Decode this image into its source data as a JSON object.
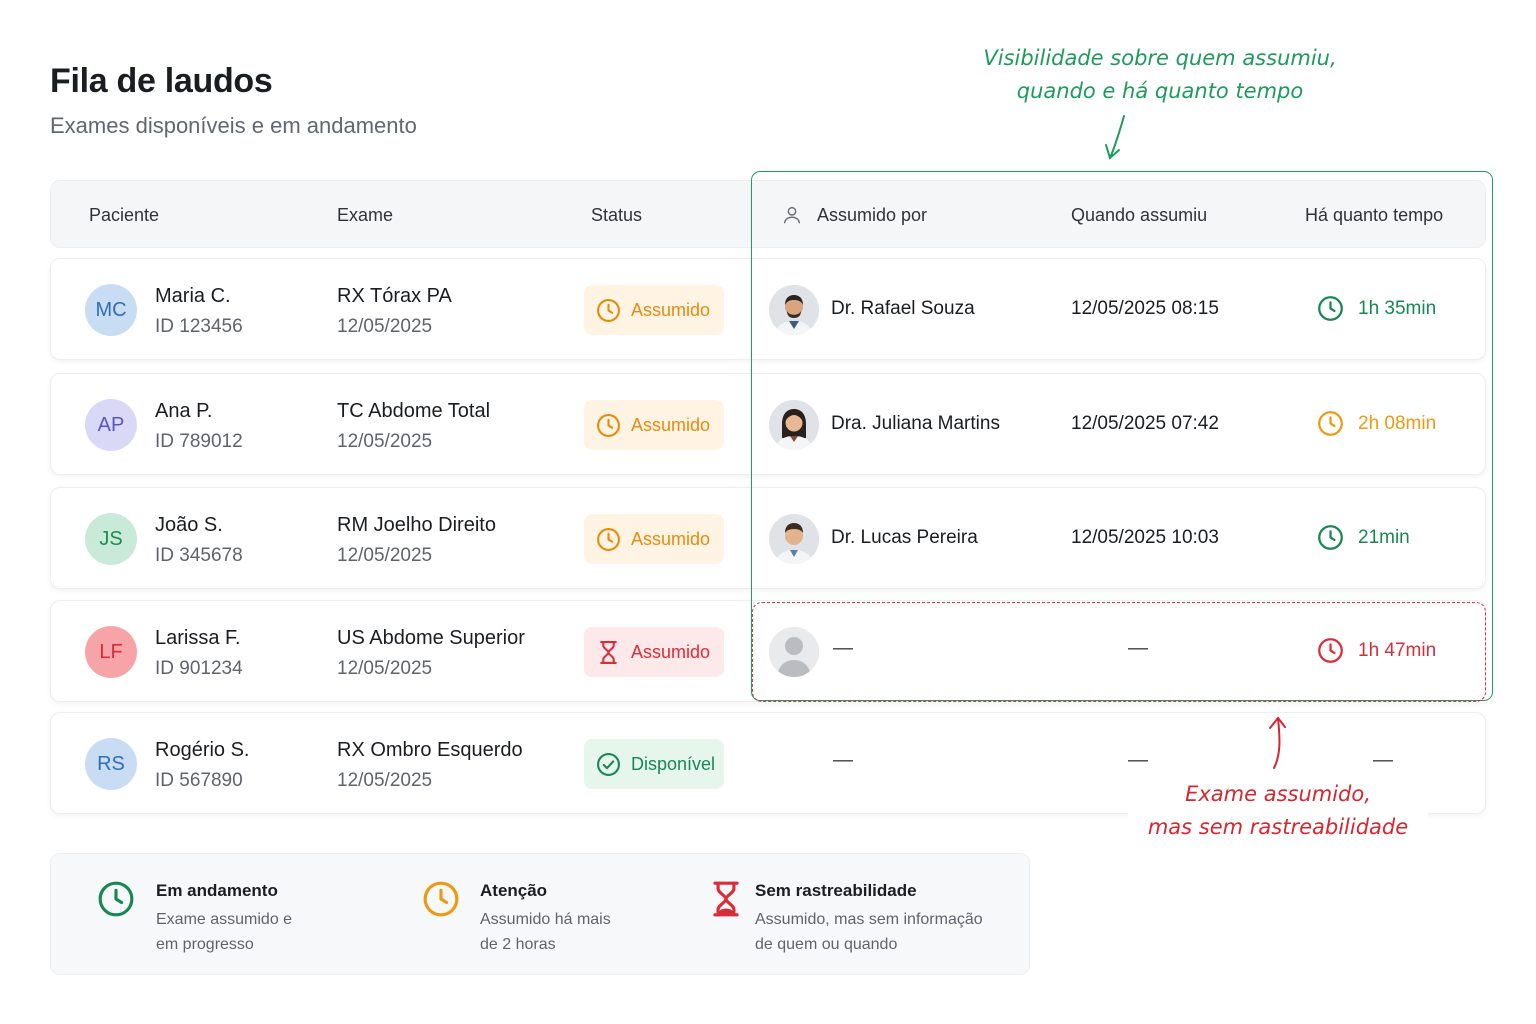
{
  "page": {
    "title": "Fila de laudos",
    "subtitle": "Exames disponíveis e em andamento"
  },
  "table": {
    "headers": {
      "paciente": "Paciente",
      "exame": "Exame",
      "status": "Status",
      "assumido_por": "Assumido por",
      "quando": "Quando assumiu",
      "tempo": "Há quanto tempo"
    },
    "rows": [
      {
        "initials": "MC",
        "initials_bg": "#c8dcf4",
        "initials_color": "#2f6fb3",
        "patient_name": "Maria C.",
        "patient_id": "ID 123456",
        "exam_name": "RX Tórax PA",
        "exam_date": "12/05/2025",
        "status_label": "Assumido",
        "status_icon": "clock-icon",
        "status_color": "#e58b0c",
        "doctor": "Dr. Rafael Souza",
        "when": "12/05/2025 08:15",
        "elapsed": "1h 35min",
        "elapsed_color": "#198754"
      },
      {
        "initials": "AP",
        "initials_bg": "#d9d8f6",
        "initials_color": "#5b54c7",
        "patient_name": "Ana P.",
        "patient_id": "ID 789012",
        "exam_name": "TC Abdome Total",
        "exam_date": "12/05/2025",
        "status_label": "Assumido",
        "status_icon": "clock-icon",
        "status_color": "#e58b0c",
        "doctor": "Dra. Juliana Martins",
        "when": "12/05/2025 07:42",
        "elapsed": "2h 08min",
        "elapsed_color": "#ed9a12"
      },
      {
        "initials": "JS",
        "initials_bg": "#c9ead8",
        "initials_color": "#1e8a50",
        "patient_name": "João S.",
        "patient_id": "ID 345678",
        "exam_name": "RM Joelho Direito",
        "exam_date": "12/05/2025",
        "status_label": "Assumido",
        "status_icon": "clock-icon",
        "status_color": "#e58b0c",
        "doctor": "Dr. Lucas Pereira",
        "when": "12/05/2025 10:03",
        "elapsed": "21min",
        "elapsed_color": "#198754"
      },
      {
        "initials": "LF",
        "initials_bg": "#f7a4a8",
        "initials_color": "#d92d3a",
        "patient_name": "Larissa F.",
        "patient_id": "ID 901234",
        "exam_name": "US Abdome Superior",
        "exam_date": "12/05/2025",
        "status_label": "Assumido",
        "status_icon": "hourglass-icon",
        "status_color": "#d92d3a",
        "doctor": "—",
        "when": "—",
        "elapsed": "1h 47min",
        "elapsed_color": "#d92d3a"
      },
      {
        "initials": "RS",
        "initials_bg": "#c8dcf4",
        "initials_color": "#2f6fb3",
        "patient_name": "Rogério S.",
        "patient_id": "ID 567890",
        "exam_name": "RX Ombro Esquerdo",
        "exam_date": "12/05/2025",
        "status_label": "Disponível",
        "status_icon": "check-circle-icon",
        "status_color": "#198754",
        "doctor": "—",
        "when": "—",
        "elapsed": "—"
      }
    ]
  },
  "annotations": {
    "visibility_note": [
      "Visibilidade sobre quem assumiu,",
      "quando e há quanto tempo"
    ],
    "trace_note": [
      "Exame assumido,",
      "mas sem rastreabilidade"
    ],
    "accent_green": "#1d9b5c",
    "accent_red": "#d7262f"
  },
  "legend": [
    {
      "icon": "clock-icon",
      "color": "#198754",
      "title": "Em andamento",
      "desc": [
        "Exame assumido e",
        "em progresso"
      ]
    },
    {
      "icon": "clock-icon",
      "color": "#ed9a12",
      "title": "Atenção",
      "desc": [
        "Assumido há mais",
        "de 2 horas"
      ]
    },
    {
      "icon": "hourglass-icon",
      "color": "#d92d3a",
      "title": "Sem rastreabilidade",
      "desc": [
        "Assumido, mas sem informação",
        "de quem ou quando"
      ]
    }
  ]
}
